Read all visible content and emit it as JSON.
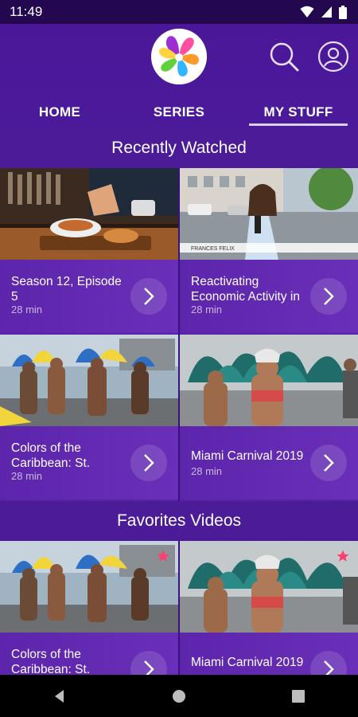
{
  "status_bar": {
    "time": "11:49",
    "icons": [
      "wifi-icon",
      "cellular-icon",
      "battery-icon"
    ]
  },
  "header": {
    "logo": "app-logo",
    "actions": [
      "search-icon",
      "profile-icon"
    ]
  },
  "tabs": [
    {
      "label": "HOME",
      "active": false
    },
    {
      "label": "SERIES",
      "active": false
    },
    {
      "label": "MY STUFF",
      "active": true
    }
  ],
  "recently_watched": {
    "title": "Recently Watched",
    "items": [
      {
        "title": "Season 12, Episode 5",
        "duration": "28 min",
        "thumb": "chef-plating"
      },
      {
        "title": "Reactivating Economic Activity in",
        "duration": "28 min",
        "thumb": "news-reporter",
        "overlay_text": "FRANCES FELIX"
      },
      {
        "title": "Colors of the Caribbean: St.",
        "duration": "28 min",
        "thumb": "carnival-parade"
      },
      {
        "title": "Miami Carnival 2019",
        "duration": "28 min",
        "thumb": "carnival-dancer"
      }
    ]
  },
  "favorites": {
    "title": "Favorites Videos",
    "items": [
      {
        "title": "Colors of the Caribbean: St.",
        "thumb": "carnival-parade",
        "favorite": true
      },
      {
        "title": "Miami Carnival 2019",
        "thumb": "carnival-dancer",
        "favorite": true
      }
    ]
  },
  "nav_bar": [
    "back-icon",
    "home-icon",
    "recents-icon"
  ],
  "colors": {
    "background": "#3d1484",
    "card": "#5c25ab",
    "tab_underline": "#d9d0ee",
    "favorite_star": "#ff3d6e"
  }
}
